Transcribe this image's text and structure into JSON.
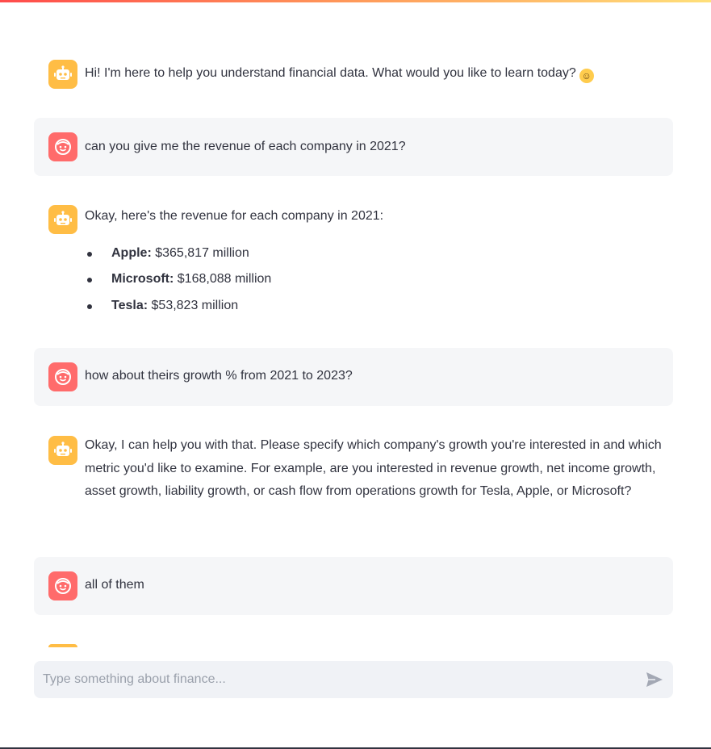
{
  "messages": [
    {
      "role": "assistant",
      "text": "Hi! I'm here to help you understand financial data. What would you like to learn today?",
      "emoji": "smiling-face"
    },
    {
      "role": "user",
      "text": "can you give me the revenue of each company in 2021?"
    },
    {
      "role": "assistant",
      "intro": "Okay, here's the revenue for each company in 2021:",
      "items": [
        {
          "company": "Apple:",
          "value": "$365,817 million"
        },
        {
          "company": "Microsoft:",
          "value": "$168,088 million"
        },
        {
          "company": "Tesla:",
          "value": "$53,823 million"
        }
      ]
    },
    {
      "role": "user",
      "text": "how about theirs growth % from 2021 to 2023?"
    },
    {
      "role": "assistant",
      "text": "Okay, I can help you with that. Please specify which company's growth you're interested in and which metric you'd like to examine. For example, are you interested in revenue growth, net income growth, asset growth, liability growth, or cash flow from operations growth for Tesla, Apple, or Microsoft?"
    },
    {
      "role": "user",
      "text": "all of them"
    }
  ],
  "input": {
    "placeholder": "Type something about finance..."
  },
  "icons": {
    "assistant_avatar": "robot-icon",
    "user_avatar": "smiley-face-icon",
    "send": "send-icon"
  },
  "colors": {
    "assistant_avatar": "#ffbd45",
    "user_avatar": "#ff6b6b",
    "user_bubble": "#f5f6f8",
    "input_bg": "#f0f2f6"
  }
}
